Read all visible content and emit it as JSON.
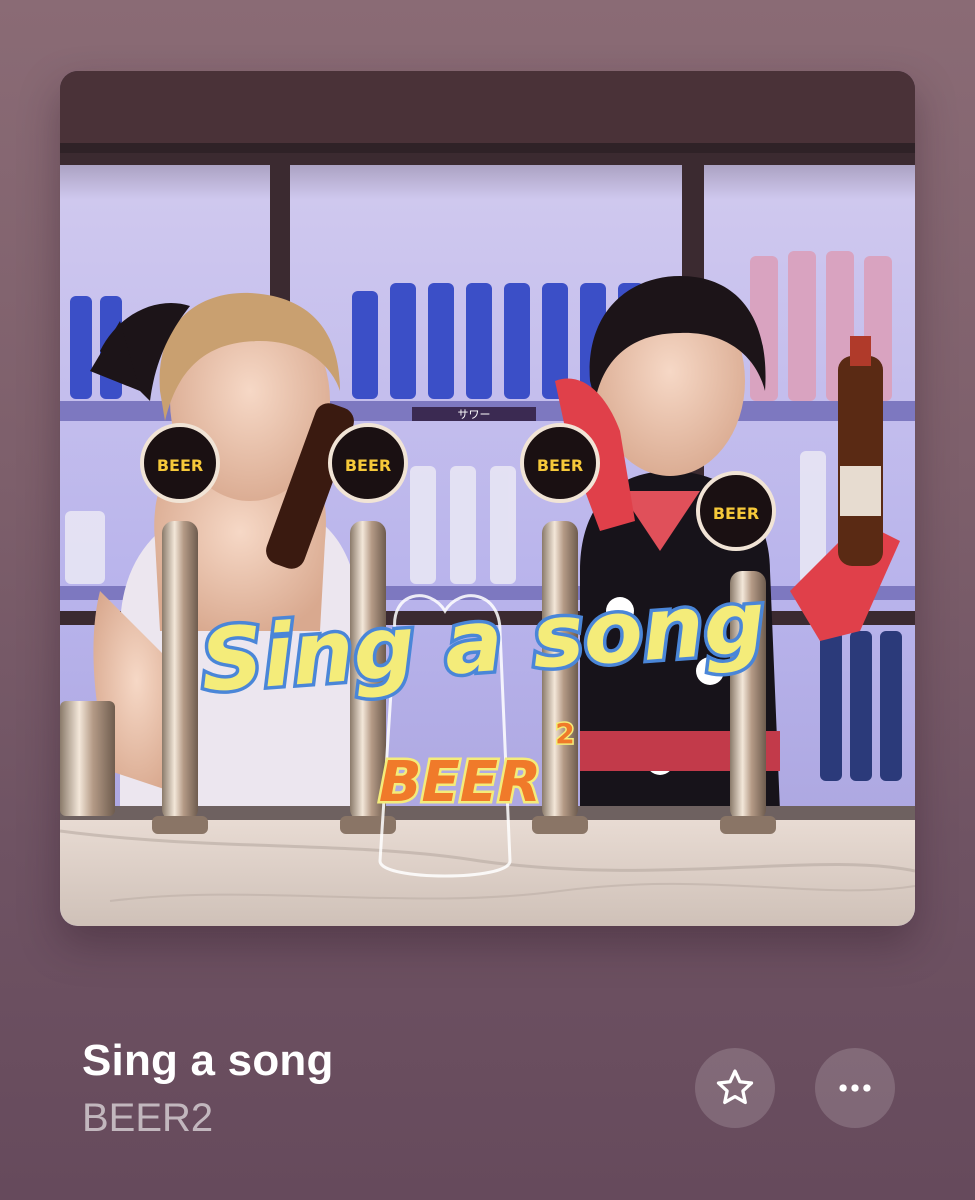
{
  "track": {
    "title": "Sing a song",
    "artist": "BEER2"
  },
  "artwork": {
    "title_art": "Sing a song",
    "logo_text": "BEER",
    "logo_superscript": "2",
    "tap_badge_text": "BEER",
    "shelf_label": "サワー"
  },
  "actions": {
    "favorite_icon": "star-outline-icon",
    "more_icon": "ellipsis-icon"
  },
  "colors": {
    "background": "#7d5f6b",
    "title_text": "#ffffff",
    "artist_text": "#c9b5bf",
    "button_fill": "rgba(255,255,255,0.16)",
    "title_yellow": "#f4ec7a",
    "title_outline": "#4a86d8",
    "logo_orange": "#f07a2a"
  }
}
